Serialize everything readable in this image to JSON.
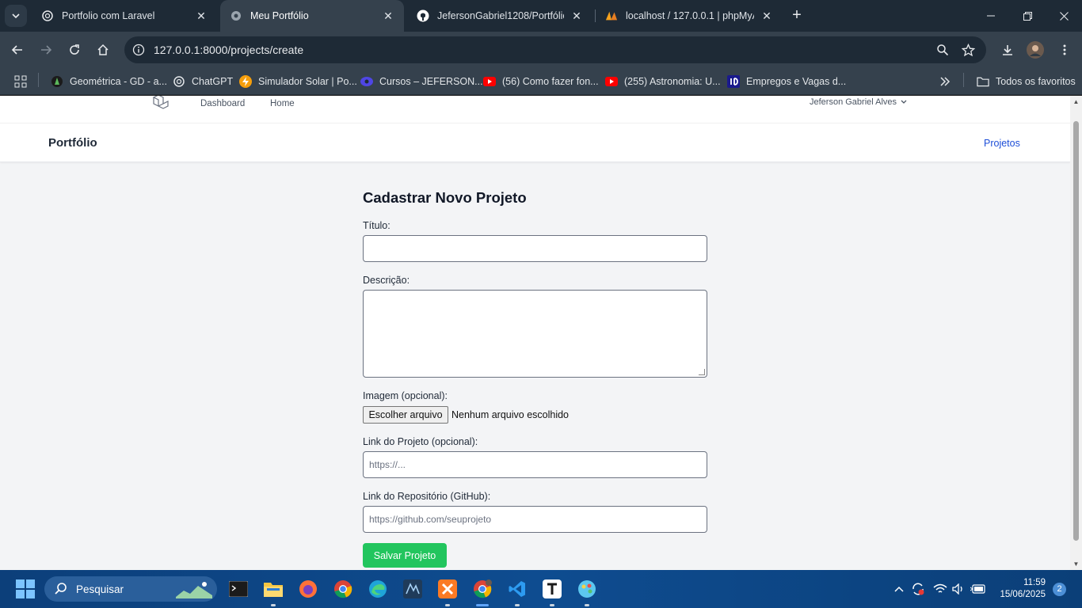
{
  "browser": {
    "tabs": [
      {
        "title": "Portfolio com Laravel",
        "active": false
      },
      {
        "title": "Meu Portfólio",
        "active": true
      },
      {
        "title": "JefersonGabriel1208/Portfólio",
        "active": false
      },
      {
        "title": "localhost / 127.0.0.1 | phpMyAdmin",
        "active": false
      }
    ],
    "url": "127.0.0.1:8000/projects/create",
    "bookmarks": [
      "Geométrica - GD - a...",
      "ChatGPT",
      "Simulador Solar | Po...",
      "Cursos – JEFERSON...",
      "(56) Como fazer fon...",
      "(255) Astronomia: U...",
      "Empregos e Vagas d..."
    ],
    "all_bookmarks_label": "Todos os favoritos"
  },
  "app": {
    "nav": {
      "dashboard": "Dashboard",
      "home": "Home",
      "user_name": "Jeferson Gabriel Alves"
    },
    "header": {
      "brand": "Portfólio",
      "projects_link": "Projetos"
    },
    "form": {
      "heading": "Cadastrar Novo Projeto",
      "title_label": "Título:",
      "title_value": "",
      "description_label": "Descrição:",
      "description_value": "",
      "image_label": "Imagem (opcional):",
      "file_button": "Escolher arquivo",
      "file_status": "Nenhum arquivo escolhido",
      "link_label": "Link do Projeto (opcional):",
      "link_placeholder": "https://...",
      "repo_label": "Link do Repositório (GitHub):",
      "repo_placeholder": "https://github.com/seuprojeto",
      "submit": "Salvar Projeto"
    }
  },
  "taskbar": {
    "search_placeholder": "Pesquisar",
    "time": "11:59",
    "date": "15/06/2025",
    "notifications": "2"
  },
  "colors": {
    "accent_green": "#22c55e",
    "link_blue": "#1d4ed8",
    "page_bg": "#f3f4f6"
  }
}
